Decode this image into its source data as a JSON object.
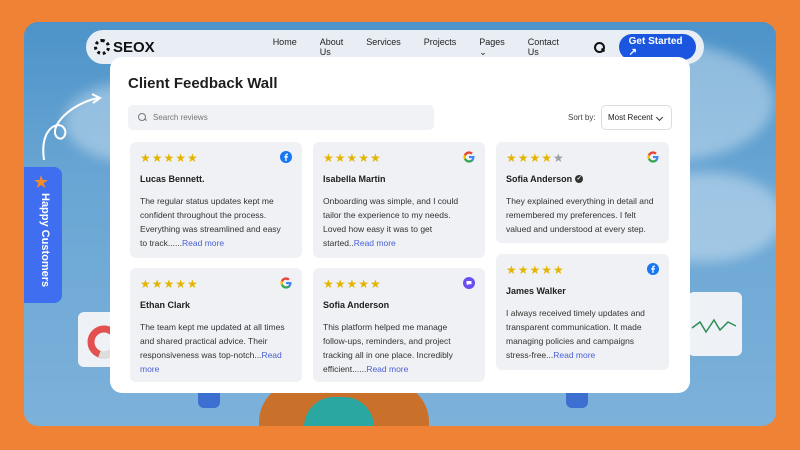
{
  "nav": {
    "logo": "SEOX",
    "links": [
      "Home",
      "About Us",
      "Services",
      "Projects",
      "Pages",
      "Contact Us"
    ],
    "cta": "Get Started ↗"
  },
  "badge": {
    "label": "Happy Customers"
  },
  "wall": {
    "title": "Client Feedback Wall",
    "search_placeholder": "Search reviews",
    "sort_label": "Sort by:",
    "sort_value": "Most Recent"
  },
  "reviews": [
    {
      "name": "Lucas Bennett.",
      "stars": 5,
      "source": "facebook-icon",
      "text": "The regular status updates kept me confident throughout the process. Everything was streamlined and easy to track......",
      "more": "Read more"
    },
    {
      "name": "Isabella Martin",
      "stars": 5,
      "source": "google-icon",
      "text": "Onboarding was simple, and I could tailor the experience to my needs. Loved how easy it was to get started..",
      "more": "Read more"
    },
    {
      "name": "Sofia Anderson",
      "stars": 4,
      "source": "google-icon",
      "verified": true,
      "text": "They explained everything in detail and remembered my preferences. I felt valued and understood at every step.",
      "more": ""
    },
    {
      "name": "Ethan Clark",
      "stars": 5,
      "source": "google-icon",
      "text": "The team kept me updated at all times and shared practical advice. Their responsiveness was top-notch...",
      "more": "Read more"
    },
    {
      "name": "Sofia Anderson",
      "stars": 5,
      "source": "chat-icon",
      "text": "This platform helped me manage follow-ups, reminders, and project tracking all in one place. Incredibly efficient......",
      "more": "Read more"
    },
    {
      "name": "James Walker",
      "stars": 5,
      "source": "facebook-icon",
      "text": "I always received timely updates and transparent communication. It made managing policies and campaigns stress-free...",
      "more": "Read more"
    }
  ],
  "colors": {
    "accent": "#3f6ef0",
    "star": "#e4b500",
    "link": "#4a5fd6",
    "frame": "#f08236"
  }
}
